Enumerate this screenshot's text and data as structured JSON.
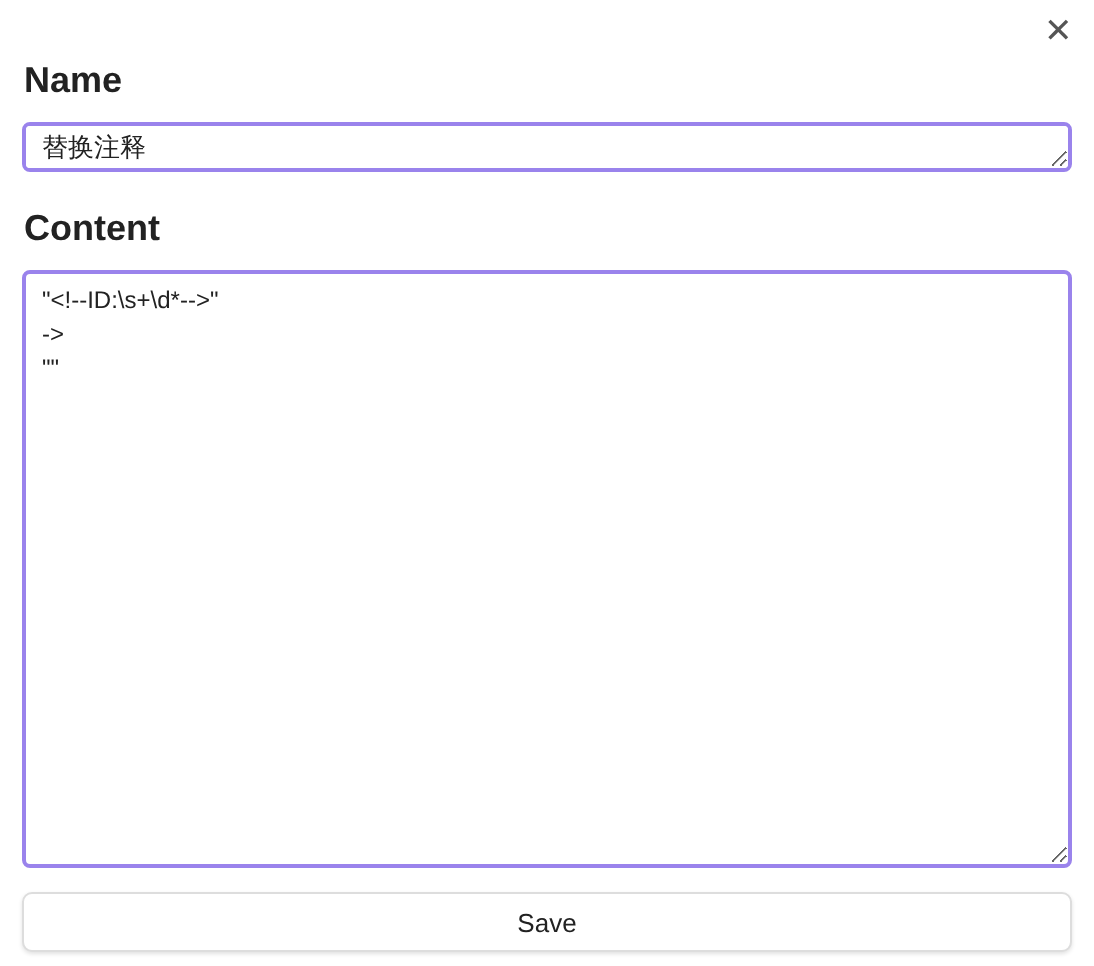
{
  "close": {
    "glyph": "✕"
  },
  "fields": [
    {
      "label": "Name",
      "value": "替换注释",
      "kind": "line"
    },
    {
      "label": "Content",
      "value": "\"<!--ID:\\s+\\d*-->\"\n->\n\"\"",
      "kind": "area"
    }
  ],
  "button": {
    "label": "Save"
  }
}
